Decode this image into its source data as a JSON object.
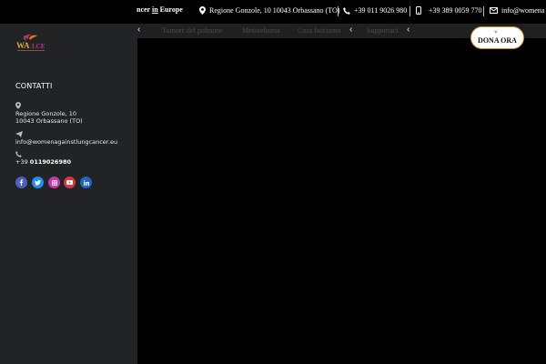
{
  "topbar": {
    "brand_prefix": "ncer ",
    "brand_in": "in",
    "brand_suffix": " Europe",
    "address": "Regione Gonzole, 10 10043 Orbassano (TO)",
    "phone": "+39 011 9026 980",
    "mobile": "+39 389 0059 770",
    "email": "info@womena"
  },
  "nav": {
    "prev_chevron": "‹",
    "next_chevron": "‹",
    "end_chevron": "‹",
    "items": [
      "Tumore del polmone",
      "Mesotelioma",
      "Cosa facciamo",
      "Supportaci"
    ]
  },
  "donate": {
    "label": "DONA ORA",
    "heart": "♥"
  },
  "sidebar": {
    "logo_text": "WALCE",
    "heading": "CONTATTI",
    "address_line1": "Regione Gonzole, 10",
    "address_line2": "10043 Orbassano (TO)",
    "email": "info@womenagainstlungcancer.eu",
    "phone_prefix": "+39 ",
    "phone_number": "0119026980"
  },
  "social": [
    {
      "name": "facebook",
      "color": "#4a5fbf"
    },
    {
      "name": "twitter",
      "color": "#1d8fe8"
    },
    {
      "name": "instagram",
      "color": "#c13aa8"
    },
    {
      "name": "youtube",
      "color": "#d9343a"
    },
    {
      "name": "linkedin",
      "color": "#1d66c7"
    }
  ],
  "colors": {
    "panel_bg": "#222325",
    "accent": "#d88a30"
  }
}
